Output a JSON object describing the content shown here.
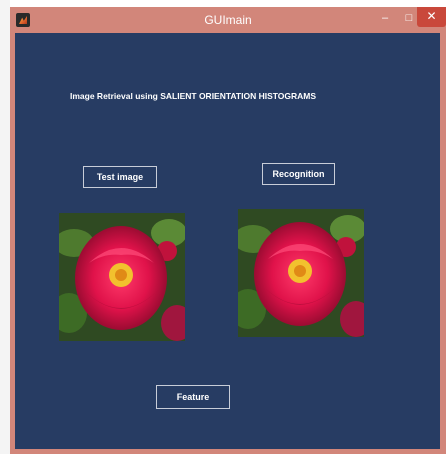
{
  "window": {
    "title": "GUImain"
  },
  "controls": {
    "minimize": "–",
    "maximize": "□",
    "close": "✕"
  },
  "heading": "Image Retrieval using SALIENT ORIENTATION HISTOGRAMS",
  "buttons": {
    "test_image": "Test image",
    "recognition": "Recognition",
    "feature": "Feature"
  },
  "colors": {
    "client_bg": "#273c63",
    "titlebar": "#d2867a",
    "close": "#c9483b"
  },
  "icons": {
    "app": "matlab-icon"
  }
}
